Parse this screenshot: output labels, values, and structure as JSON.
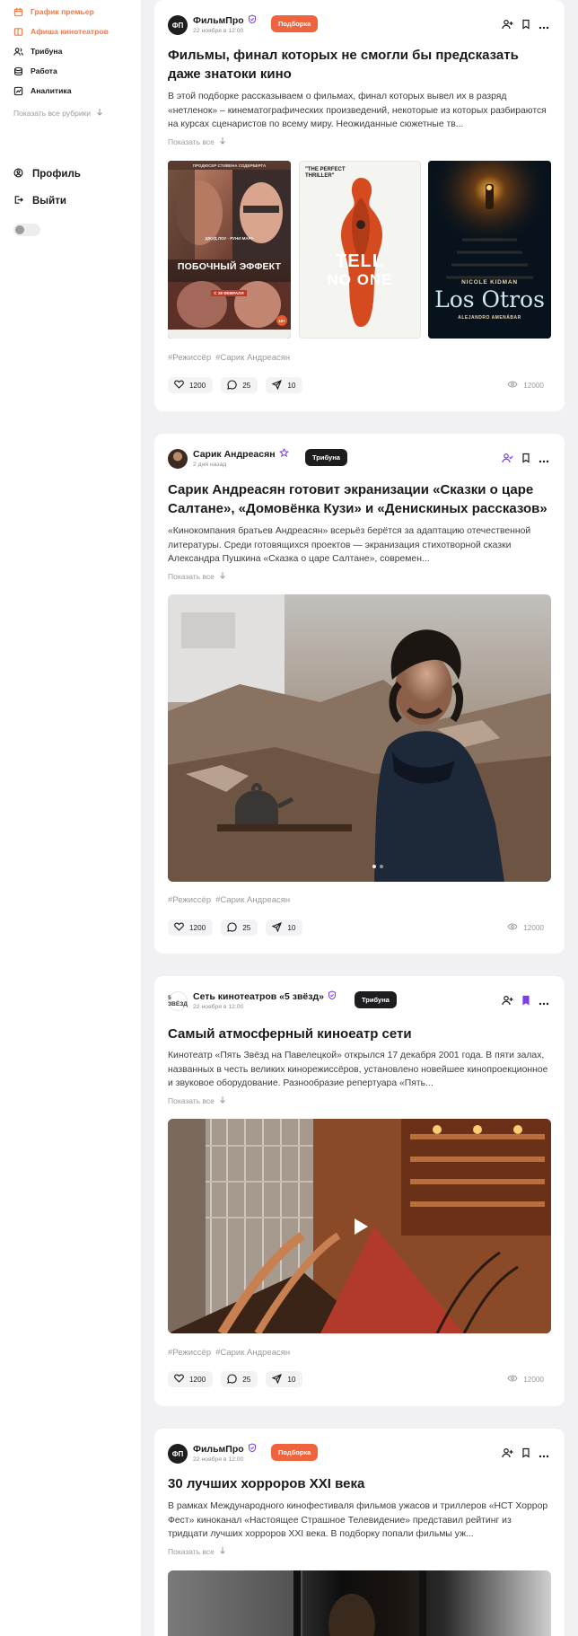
{
  "sidebar": {
    "items": [
      {
        "label": "График премьер",
        "icon": "calendar-icon"
      },
      {
        "label": "Афиша кинотеатров",
        "icon": "ticket-icon"
      },
      {
        "label": "Трибуна",
        "icon": "users-icon"
      },
      {
        "label": "Работа",
        "icon": "briefcase-icon"
      },
      {
        "label": "Аналитика",
        "icon": "analytics-icon"
      }
    ],
    "show_all_rubrics": "Показать все рубрики",
    "profile": "Профиль",
    "logout": "Выйти"
  },
  "colors": {
    "accent": "#f07a4a",
    "tag_orange": "#f0643d",
    "tag_dark": "#1d1d1f",
    "purple": "#7b3fe4"
  },
  "posts": [
    {
      "avatar": "ФП",
      "author": "ФильмПро",
      "date": "22 ноября в 12:00",
      "tag": "Подборка",
      "title": "Фильмы, финал которых не смогли бы предсказать даже знатоки кино",
      "excerpt": "В этой подборке рассказываем о фильмах, финал которых вывел их в разряд «нетленок» – кинематографических произведений, некоторые из которых разбираются на курсах сценаристов по всему миру. Неожиданные сюжетные тв...",
      "show_all": "Показать все",
      "posters": [
        {
          "top": "ПРОДЮСЕР СТИВЕНА СОДЕРБЕРГА",
          "names": "ДЖУД ЛОУ · РУНИ МАРА",
          "title": "ПОБОЧНЫЙ ЭФФЕКТ",
          "date": "С 28 ФЕВРАЛЯ",
          "rating": "18+"
        },
        {
          "quote": "\"THE PERFECT THRILLER\"",
          "title1": "TELL",
          "title2": "NO ONE"
        },
        {
          "actor": "NICOLE KIDMAN",
          "title": "Los Otros",
          "director": "ALEJANDRO AMENÁBAR"
        }
      ],
      "hashtags": [
        "#Режиссёр",
        "#Сарик Андреасян"
      ],
      "likes": "1200",
      "comments": "25",
      "shares": "10",
      "views": "12000"
    },
    {
      "author": "Сарик Андреасян",
      "date": "2 дня назад",
      "tag": "Трибуна",
      "title": "Сарик Андреасян готовит экранизации «Сказки о царе Салтане», «Домовёнка Кузи» и «Денискиных рассказов»",
      "excerpt": "«Кинокомпания братьев Андреасян» всерьёз берётся за адаптацию отечественной литературы. Среди готовящихся проектов — экранизация стихотворной сказки Александра Пушкина «Сказка о царе Салтане», современ...",
      "show_all": "Показать все",
      "hashtags": [
        "#Режиссёр",
        "#Сарик Андреасян"
      ],
      "likes": "1200",
      "comments": "25",
      "shares": "10",
      "views": "12000"
    },
    {
      "avatar": "5 ЗВЁЗД",
      "author": "Сеть кинотеатров «5 звёзд»",
      "date": "22 ноября в 12:00",
      "tag": "Трибуна",
      "title": "Самый атмосферный киноеатр сети",
      "excerpt": "Кинотеатр «Пять Звёзд на Павелецкой» открылся 17 декабря 2001 года. В пяти залах, названных в честь великих кинорежиссёров, установлено новейшее кинопроекционное и звуковое оборудование. Разнообразие репертуара «Пять...",
      "show_all": "Показать все",
      "hashtags": [
        "#Режиссёр",
        "#Сарик Андреасян"
      ],
      "likes": "1200",
      "comments": "25",
      "shares": "10",
      "views": "12000"
    },
    {
      "avatar": "ФП",
      "author": "ФильмПро",
      "date": "22 ноября в 12:00",
      "tag": "Подборка",
      "title": "30 лучших хорроров XXI века",
      "excerpt": "В рамках Международного кинофестиваля фильмов ужасов и триллеров «НСТ Хоррор Фест» киноканал «Настоящее Страшное Телевидение» представил рейтинг из тридцати лучших хорроров XXI века. В подборку попали фильмы уж...",
      "show_all": "Показать все"
    }
  ]
}
